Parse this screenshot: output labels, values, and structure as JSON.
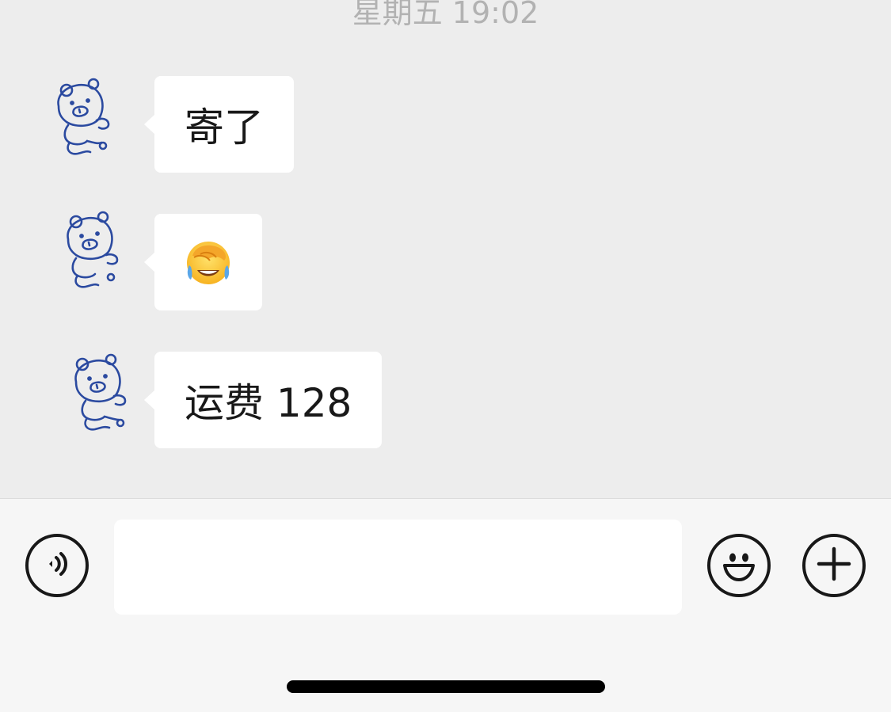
{
  "chat": {
    "timestamp": "星期五 19:02",
    "messages": [
      {
        "sender": "other",
        "avatar_icon": "bear-sketch-avatar-icon",
        "type": "text",
        "text": "寄了"
      },
      {
        "sender": "other",
        "avatar_icon": "bear-sketch-avatar-icon",
        "type": "emoji",
        "emoji_icon": "facepalm-laughing-emoji-icon"
      },
      {
        "sender": "other",
        "avatar_icon": "bear-sketch-avatar-icon",
        "type": "text",
        "text": "运费 128"
      }
    ]
  },
  "input_bar": {
    "voice_button_icon": "voice-icon",
    "message_value": "",
    "message_placeholder": "",
    "emoji_button_icon": "smiley-icon",
    "more_button_icon": "plus-icon"
  },
  "colors": {
    "chat_background": "#ededed",
    "bubble_background": "#ffffff",
    "input_bar_background": "#f6f6f6",
    "timestamp_text": "#b2b2b2",
    "avatar_line": "#2b4aa0",
    "icon_stroke": "#181818"
  }
}
